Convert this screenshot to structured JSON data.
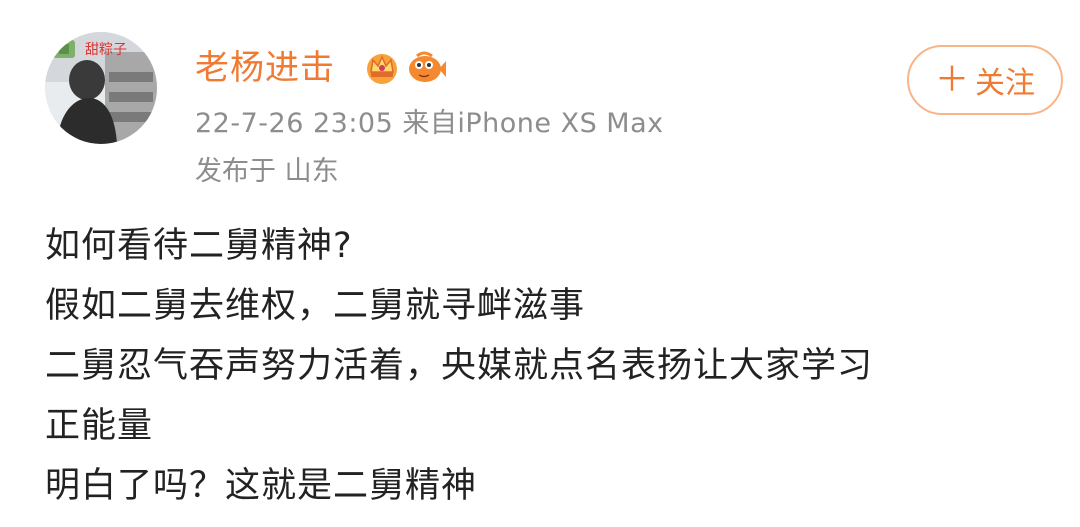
{
  "post": {
    "author": {
      "name": "老杨进击",
      "avatar_icon": "avatar-photo",
      "avatar_watermark": "甜粽子",
      "badges": [
        "crown-badge-icon",
        "fish-badge-icon"
      ]
    },
    "meta": {
      "time_source": "22-7-26 23:05  来自iPhone XS Max",
      "location": "发布于 山东"
    },
    "follow_button": {
      "plus": "＋",
      "label": "关注"
    },
    "content_lines": [
      "如何看待二舅精神?",
      "假如二舅去维权，二舅就寻衅滋事",
      "二舅忍气吞声努力活着，央媒就点名表扬让大家学习",
      "正能量",
      "明白了吗？这就是二舅精神"
    ]
  },
  "colors": {
    "accent": "#f07a32",
    "follow_border": "#f7b58a",
    "meta_text": "#8d8d8d",
    "body_text": "#222222"
  }
}
